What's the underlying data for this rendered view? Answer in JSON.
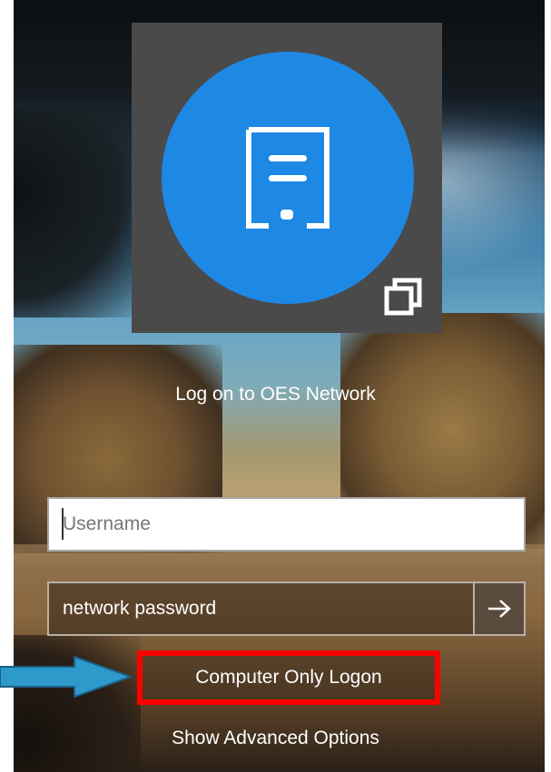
{
  "logon": {
    "title": "Log on to OES Network",
    "username_placeholder": "Username",
    "password_placeholder": "network password",
    "computer_only_label": "Computer Only Logon",
    "advanced_label": "Show Advanced Options"
  },
  "icons": {
    "avatar": "server-icon",
    "overlay": "switch-window-icon",
    "submit": "arrow-right-icon",
    "annotation": "annotation-arrow"
  },
  "colors": {
    "avatar": "#1e88e5",
    "highlight": "#ff0000",
    "annotation_arrow": "#2e9acb"
  }
}
